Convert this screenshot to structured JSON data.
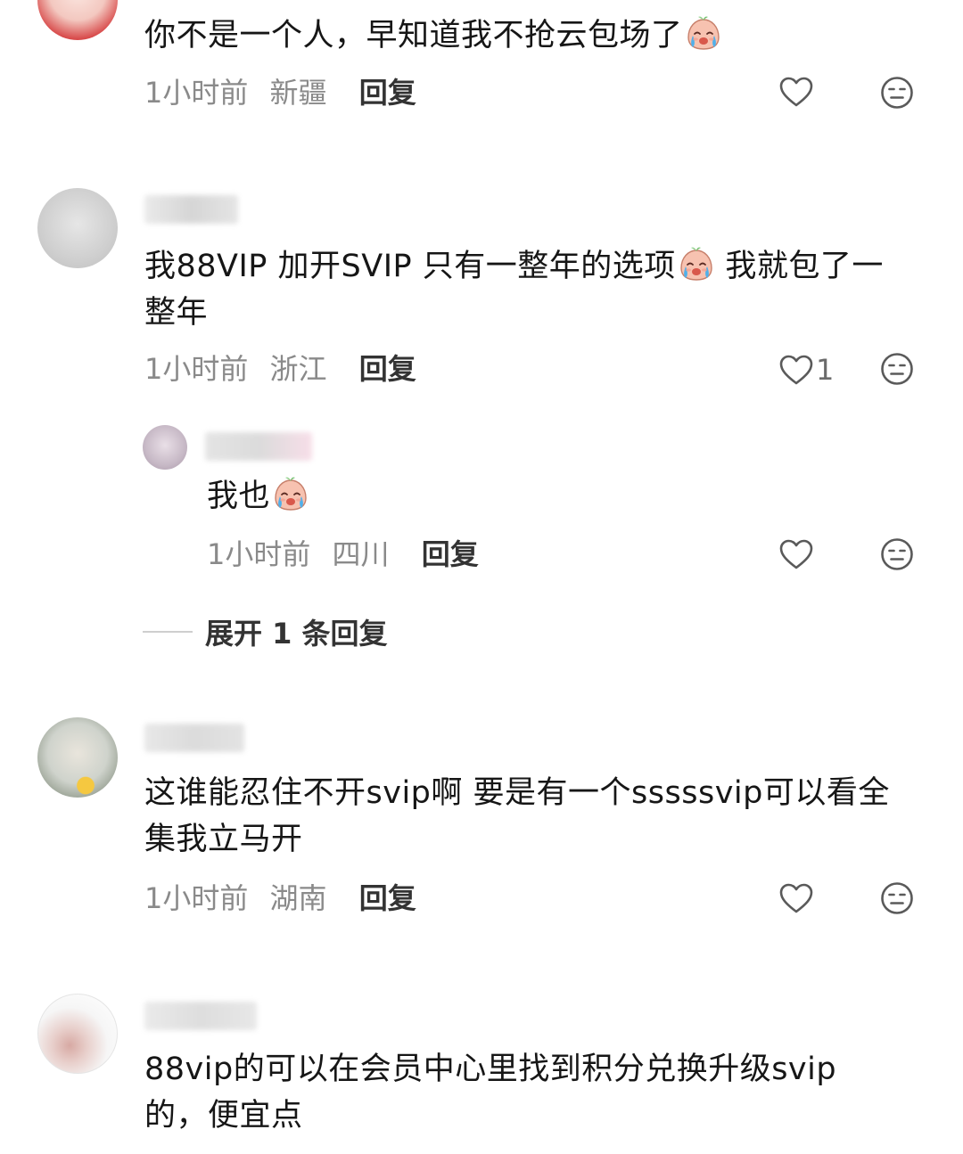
{
  "comments": [
    {
      "text": "你不是一个人，早知道我不抢云包场了",
      "time": "1小时前",
      "region": "新疆",
      "reply": "回复",
      "likes": ""
    },
    {
      "username": "",
      "text_line1": "我88VIP 加开SVIP 只有一整年的选项",
      "text_line1b": "我就包了一",
      "text_line2": "整年",
      "time": "1小时前",
      "region": "浙江",
      "reply": "回复",
      "likes": "1",
      "sub_reply": {
        "username": "",
        "text": "我也",
        "time": "1小时前",
        "region": "四川",
        "reply": "回复"
      },
      "expand_label": "展开 1 条回复"
    },
    {
      "username": "",
      "text_line1": "这谁能忍住不开svip啊 要是有一个sssssvip可以看全",
      "text_line2": "集我立马开",
      "time": "1小时前",
      "region": "湖南",
      "reply": "回复"
    },
    {
      "username": "",
      "text_line1": "88vip的可以在会员中心里找到积分兑换升级svip",
      "text_line2": "的，便宜点"
    }
  ],
  "icons": {
    "like": "heart-outline-icon",
    "dislike": "neutral-face-icon",
    "emoji": "crying-face-emoji"
  },
  "colors": {
    "text": "#161616",
    "meta": "#8a8a8a",
    "reply": "#333333",
    "icon": "#5a5a5a"
  }
}
